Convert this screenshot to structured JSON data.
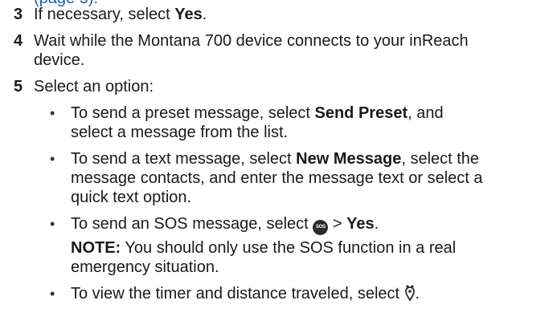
{
  "top_partial": {
    "text": "(page 5)."
  },
  "steps": {
    "s3": {
      "number": "3",
      "prefix": "If necessary, select ",
      "bold": "Yes",
      "suffix": "."
    },
    "s4": {
      "number": "4",
      "line1": "Wait while the Montana 700 device connects to your inReach",
      "line2": "device."
    },
    "s5": {
      "number": "5",
      "text": "Select an option:"
    }
  },
  "options": {
    "preset": {
      "bullet": "•",
      "l1_prefix": "To send a preset message, select ",
      "l1_bold": "Send Preset",
      "l1_suffix": ", and",
      "l2": "select a message from the list."
    },
    "text_msg": {
      "bullet": "•",
      "l1_prefix": "To send a text message, select ",
      "l1_bold": "New Message",
      "l1_suffix": ", select the",
      "l2": "message contacts, and enter the message text or select a",
      "l3": "quick text option."
    },
    "sos": {
      "bullet": "•",
      "prefix": "To send an SOS message, select ",
      "icon_name": "sos-icon",
      "icon_text": "SOS",
      "middle": " > ",
      "bold": "Yes",
      "suffix": "."
    },
    "note": {
      "label": "NOTE:",
      "l1_rest": " You should only use the SOS function in a real",
      "l2": "emergency situation."
    },
    "timer": {
      "bullet": "•",
      "prefix": "To view the timer and distance traveled, select ",
      "icon_name": "track-icon",
      "suffix": "."
    }
  }
}
